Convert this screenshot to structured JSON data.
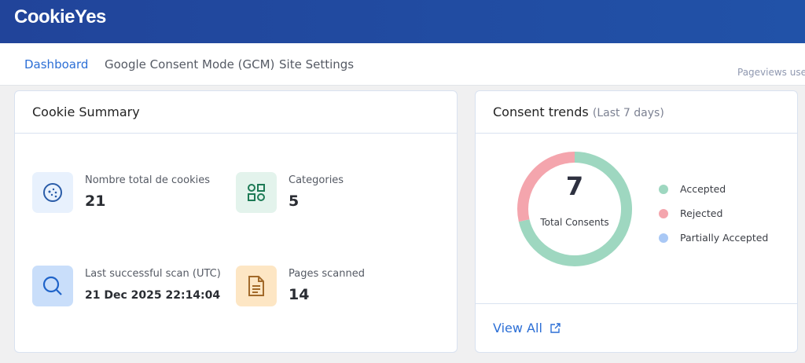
{
  "header": {
    "logo": "CookieYes"
  },
  "nav": {
    "tabs": [
      {
        "label": "Dashboard",
        "active": true
      },
      {
        "label": "Google Consent Mode (GCM)"
      },
      {
        "label": "Site Settings"
      }
    ],
    "pageviews_label": "Pageviews used"
  },
  "cookie_summary": {
    "title": "Cookie Summary",
    "stats": [
      {
        "label": "Nombre total de cookies",
        "value": "21",
        "icon": "cookie-icon",
        "color": "#e8f1fd"
      },
      {
        "label": "Categories",
        "value": "5",
        "icon": "categories-grid-icon",
        "color": "#e3f3ec"
      },
      {
        "label": "Last successful scan (UTC)",
        "value": "21 Dec 2025 22:14:04",
        "icon": "search-icon",
        "color": "#c9defa"
      },
      {
        "label": "Pages scanned",
        "value": "14",
        "icon": "document-icon",
        "color": "#fde6c4"
      }
    ]
  },
  "consent_trends": {
    "title": "Consent trends",
    "subtitle": "(Last 7 days)",
    "total": "7",
    "total_label": "Total Consents",
    "chart_data": {
      "type": "pie",
      "categories": [
        "Accepted",
        "Rejected",
        "Partially Accepted"
      ],
      "values": [
        5,
        2,
        0
      ],
      "colors": [
        "#9ed7c0",
        "#f4a5ad",
        "#a9c8f5"
      ],
      "legend": "right"
    },
    "legend": [
      "Accepted",
      "Rejected",
      "Partially Accepted"
    ],
    "view_all": "View All"
  }
}
